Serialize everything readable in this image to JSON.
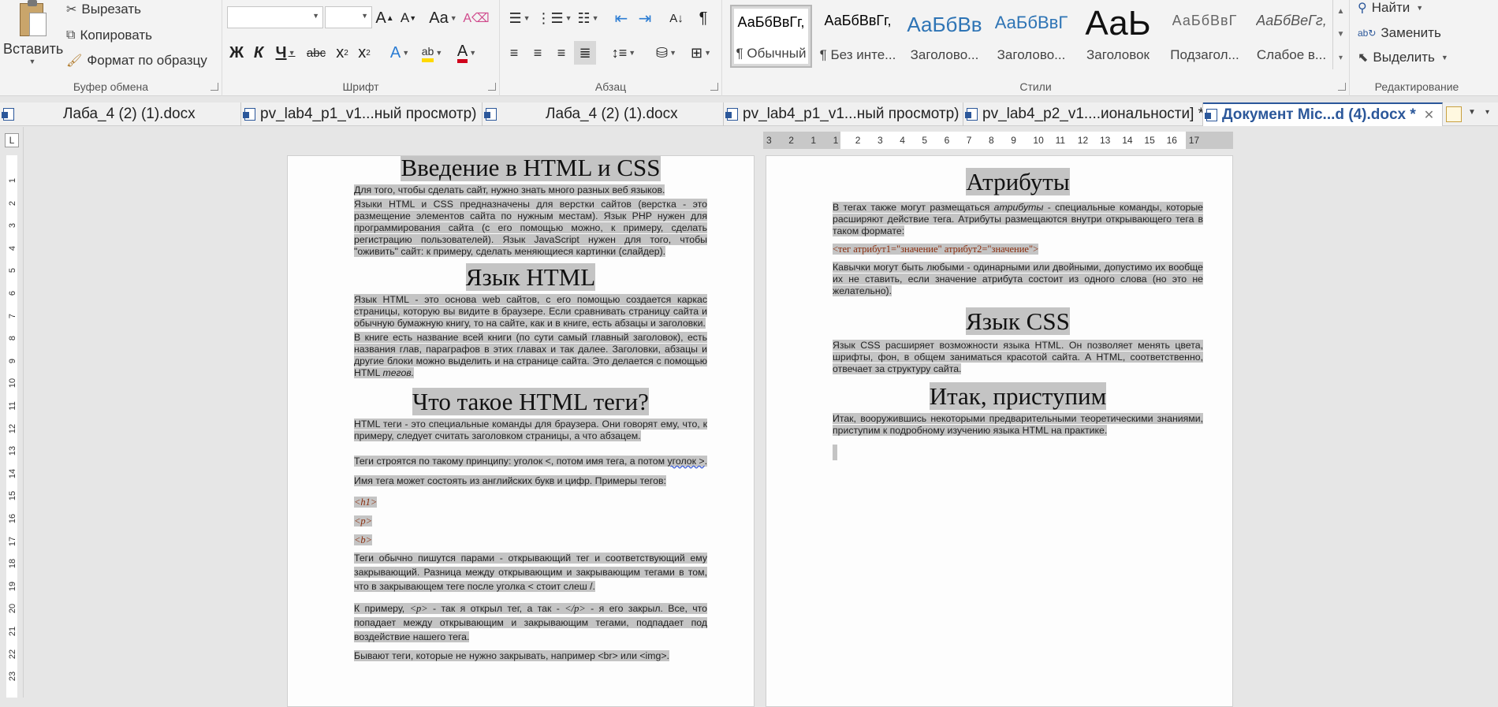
{
  "clipboard": {
    "paste": "Вставить",
    "cut": "Вырезать",
    "copy": "Копировать",
    "format_painter": "Формат по образцу",
    "group_label": "Буфер обмена"
  },
  "font": {
    "group_label": "Шрифт",
    "font_name": "",
    "font_size": "",
    "grow": "A",
    "shrink": "A",
    "case": "Aa",
    "bold": "Ж",
    "italic": "К",
    "underline": "Ч",
    "strike": "abc",
    "subscript": "x",
    "superscript": "x",
    "effects": "A",
    "highlight_color": "#ffd900",
    "font_color": "#d0021b"
  },
  "paragraph": {
    "group_label": "Абзац",
    "pilcrow": "¶"
  },
  "styles": {
    "group_label": "Стили",
    "items": [
      {
        "preview": "АаБбВвГг,",
        "name": "¶ Обычный"
      },
      {
        "preview": "АаБбВвГг,",
        "name": "¶ Без инте..."
      },
      {
        "preview": "АаБбВв",
        "name": "Заголово..."
      },
      {
        "preview": "АаБбВвГ",
        "name": "Заголово..."
      },
      {
        "preview": "АаЬ",
        "name": "Заголовок"
      },
      {
        "preview": "АаБбВвГ",
        "name": "Подзагол..."
      },
      {
        "preview": "АаБбВеГг,",
        "name": "Слабое в..."
      }
    ],
    "heading_color": "#2e74b5"
  },
  "editing": {
    "group_label": "Редактирование",
    "find": "Найти",
    "replace": "Заменить",
    "select": "Выделить"
  },
  "tabs": [
    {
      "label": "Лаба_4 (2) (1).docx",
      "active": false
    },
    {
      "label": "pv_lab4_p1_v1...ный просмотр)",
      "active": false
    },
    {
      "label": "Лаба_4 (2) (1).docx",
      "active": false
    },
    {
      "label": "pv_lab4_p1_v1...ный просмотр)",
      "active": false
    },
    {
      "label": "pv_lab4_p2_v1....иональности] *",
      "active": false
    },
    {
      "label": "Документ Mic...d (4).docx *",
      "active": true
    }
  ],
  "ruler": {
    "horizontal_ticks": [
      "3",
      "2",
      "1",
      "1",
      "2",
      "3",
      "4",
      "5",
      "6",
      "7",
      "8",
      "9",
      "10",
      "11",
      "12",
      "13",
      "14",
      "15",
      "16",
      "17"
    ],
    "vertical_ticks": [
      "1",
      "2",
      "3",
      "4",
      "5",
      "6",
      "7",
      "8",
      "9",
      "10",
      "11",
      "12",
      "13",
      "14",
      "15",
      "16",
      "17",
      "18",
      "19",
      "20",
      "21",
      "22",
      "23"
    ],
    "corner": "L"
  },
  "page_left": {
    "h1": "Введение в HTML и CSS",
    "p1": "Для того, чтобы сделать сайт, нужно знать много разных веб языков.",
    "p2": "Языки HTML и CSS предназначены для верстки сайтов (верстка - это размещение элементов сайта по нужным местам). Язык PHP нужен для программирования сайта (с его помощью можно, к примеру, сделать регистрацию пользователей). Язык JavaScript нужен для того, чтобы \"оживить\" сайт: к примеру, сделать меняющиеся картинки (слайдер).",
    "h2": "Язык HTML",
    "p3": "Язык HTML - это основа web сайтов, с его помощью создается каркас страницы, которую вы видите в браузере. Если сравнивать страницу сайта и обычную бумажную книгу, то на сайте, как и в книге, есть абзацы и заголовки.",
    "p4_a": "В книге есть название всей книги (по сути самый главный заголовок), есть названия глав, параграфов в этих главах и так далее. Заголовки, абзацы и другие блоки можно выделить и на странице сайта. Это делается с помощью HTML",
    "p4_b": "тегов.",
    "h3": "Что такое HTML теги?",
    "p5": "HTML теги - это специальные команды для браузера. Они говорят ему, что, к примеру, следует считать заголовком страницы, а что абзацем.",
    "p6_a": "Теги строятся по такому принципу: уголок <, потом имя тега, а потом",
    "p6_b": "уголок >",
    "p6_c": ". Имя тега может состоять из английских букв и цифр. Примеры тегов:",
    "tag1": "<h1>",
    "tag2": "<p>",
    "tag3": "<b>",
    "p7": "Теги обычно пишутся парами - открывающий тег и соответствующий ему закрывающий. Разница между открывающим и закрывающим тегами в том, что в закрывающем теге после уголка < стоит слеш /.",
    "p8_a": "К примеру, ",
    "p8_tag1": "<p>",
    "p8_b": " - так я открыл тег, а так - ",
    "p8_tag2": "</p>",
    "p8_c": " - я его закрыл. Все, что попадает между открывающим и закрывающим тегами, подпадает под воздействие нашего тега.",
    "p9": "Бывают теги, которые не нужно закрывать, например <br> или <img>."
  },
  "page_right": {
    "h1": "Атрибуты",
    "p1_a": "В тегах также могут размещаться",
    "p1_em": "атрибуты",
    "p1_b": "- специальные команды, которые расширяют действие тега. Атрибуты размещаются внутри открывающего тега в таком формате:",
    "code": "<тег атрибут1=\"значение\" атрибут2=\"значение\">",
    "p2": "Кавычки могут быть любыми - одинарными или двойными, допустимо их вообще их не ставить, если значение атрибута состоит из одного слова (но это не желательно).",
    "h2": "Язык CSS",
    "p3": "Язык CSS расширяет возможности языка HTML. Он позволяет менять цвета, шрифты, фон, в общем заниматься красотой сайта. А HTML, соответственно, отвечает за структуру сайта.",
    "h3": "Итак, приступим",
    "p4": "Итак, вооружившись некоторыми предварительными теоретическими знаниями, приступим к подробному изучению языка HTML на практике."
  }
}
